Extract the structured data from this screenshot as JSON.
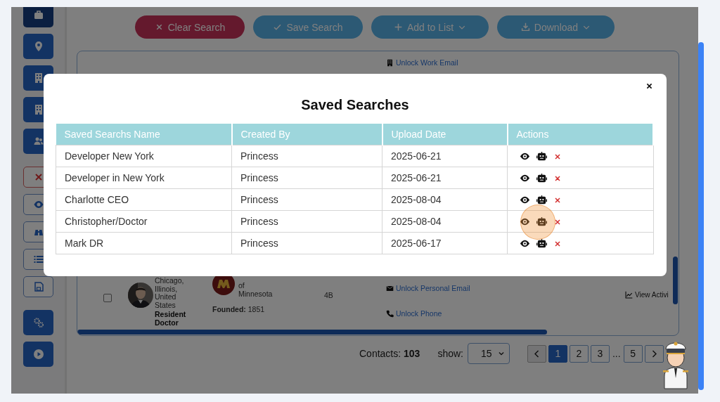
{
  "sidebar": [
    {
      "kind": "filled",
      "selected": true
    },
    {
      "kind": "filled",
      "selected": false
    },
    {
      "kind": "filled",
      "selected": false
    },
    {
      "kind": "filled",
      "selected": false
    },
    {
      "kind": "filled",
      "selected": false
    },
    {
      "kind": "danger"
    },
    {
      "kind": "outline"
    },
    {
      "kind": "outline"
    },
    {
      "kind": "outline"
    },
    {
      "kind": "outline"
    },
    {
      "kind": "filled",
      "selected": false
    },
    {
      "kind": "filled",
      "selected": false
    }
  ],
  "toolbar": [
    {
      "label": "Clear Search",
      "kind": "danger",
      "dropdown": false
    },
    {
      "label": "Save Search",
      "kind": "primary",
      "dropdown": false
    },
    {
      "label": "Add to List",
      "kind": "primary",
      "dropdown": true
    },
    {
      "label": "Download",
      "kind": "primary",
      "dropdown": true
    }
  ],
  "results": {
    "top_link": "Unlock Work Email",
    "row": {
      "checked": false,
      "location_lines": [
        "Chicago,",
        "Illinois,",
        "United",
        "States"
      ],
      "title": "Resident Doctor",
      "company_lines": [
        "of",
        "Minnesota"
      ],
      "founded": "**Founded:** 1851",
      "size": "4B",
      "links": [
        "Unlock Personal Email",
        "Unlock Phone"
      ],
      "activity": "View Activi"
    }
  },
  "footer": {
    "contacts": "Contacts: **103**",
    "show_label": "show:",
    "page_size": "15",
    "pages": [
      {
        "kind": "prev",
        "disabled": true
      },
      {
        "kind": "page",
        "label": "1",
        "selected": true
      },
      {
        "kind": "page",
        "label": "2",
        "selected": false
      },
      {
        "kind": "page",
        "label": "3",
        "selected": false
      },
      {
        "kind": "ellipsis",
        "label": "..."
      },
      {
        "kind": "page",
        "label": "5",
        "selected": false
      },
      {
        "kind": "next",
        "disabled": false
      }
    ]
  },
  "modal": {
    "title": "Saved Searches",
    "columns": [
      "Saved Searchs Name",
      "Created By",
      "Upload Date",
      "Actions"
    ],
    "rows": [
      {
        "name": "Developer New York",
        "created_by": "Princess",
        "date": "2025-06-21"
      },
      {
        "name": "Developer in New York",
        "created_by": "Princess",
        "date": "2025-06-21"
      },
      {
        "name": "Charlotte CEO",
        "created_by": "Princess",
        "date": "2025-08-04"
      },
      {
        "name": "Christopher/Doctor",
        "created_by": "Princess",
        "date": "2025-08-04"
      },
      {
        "name": "Mark DR",
        "created_by": "Princess",
        "date": "2025-06-17"
      }
    ]
  }
}
